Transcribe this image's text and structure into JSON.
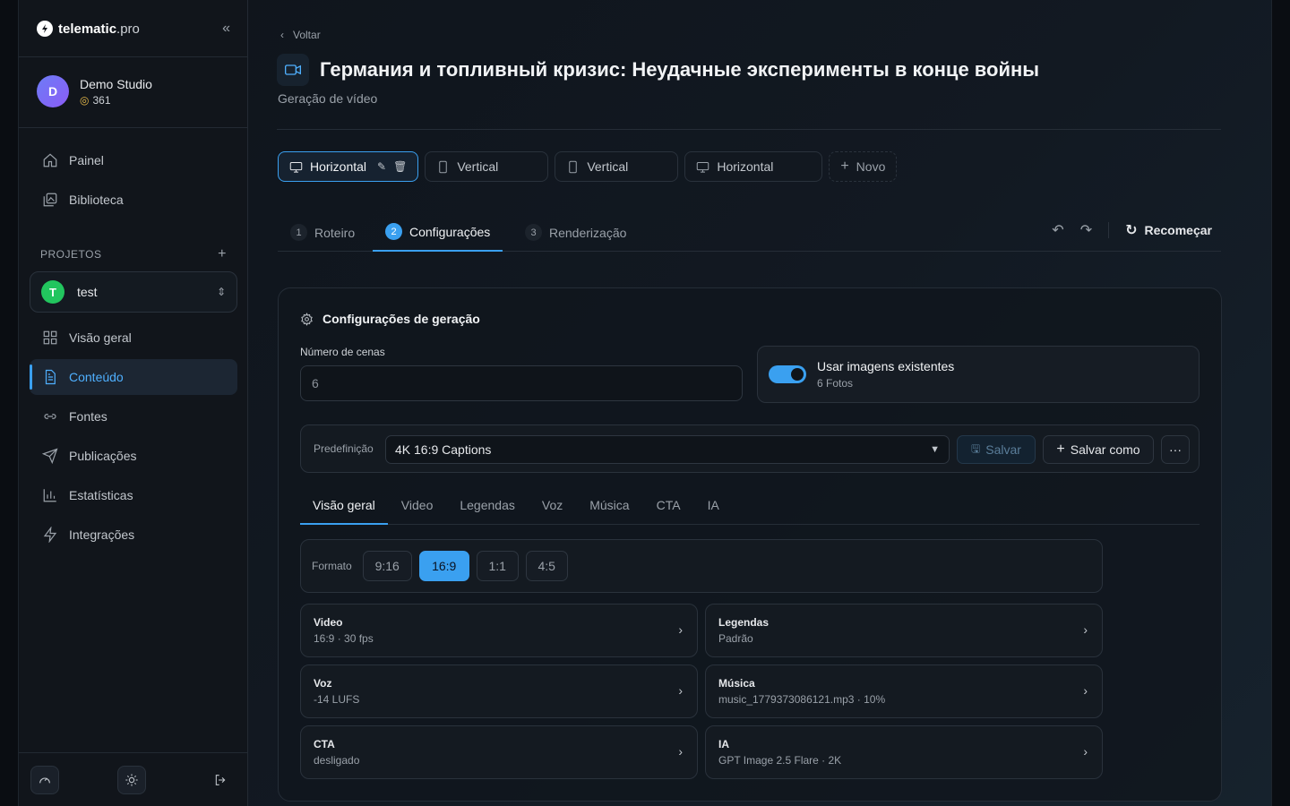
{
  "sidebar": {
    "logo": {
      "bold": "telematic",
      "thin": ".pro"
    },
    "studio": {
      "initial": "D",
      "name": "Demo Studio",
      "credits": "361"
    },
    "nav_top": [
      {
        "label": "Painel",
        "icon": "home-icon"
      },
      {
        "label": "Biblioteca",
        "icon": "library-icon"
      }
    ],
    "projects_label": "PROJETOS",
    "project": {
      "initial": "T",
      "name": "test"
    },
    "nav_project": [
      {
        "label": "Visão geral",
        "icon": "grid-icon"
      },
      {
        "label": "Conteúdo",
        "icon": "document-icon",
        "active": true
      },
      {
        "label": "Fontes",
        "icon": "link-icon"
      },
      {
        "label": "Publicações",
        "icon": "send-icon"
      },
      {
        "label": "Estatísticas",
        "icon": "bar-chart-icon"
      },
      {
        "label": "Integrações",
        "icon": "bolt-icon"
      }
    ]
  },
  "header": {
    "back": "Voltar",
    "title": "Германия и топливный кризис: Неудачные эксперименты в конце войны",
    "subtitle": "Geração de vídeo"
  },
  "variants": [
    {
      "label": "Horizontal",
      "icon": "monitor-icon",
      "active": true
    },
    {
      "label": "Vertical",
      "icon": "phone-icon"
    },
    {
      "label": "Vertical",
      "icon": "phone-icon"
    },
    {
      "label": "Horizontal",
      "icon": "monitor-icon"
    },
    {
      "label": "Novo",
      "icon": "plus-icon"
    }
  ],
  "steps": [
    {
      "num": "1",
      "label": "Roteiro"
    },
    {
      "num": "2",
      "label": "Configurações",
      "active": true
    },
    {
      "num": "3",
      "label": "Renderização"
    }
  ],
  "restart_label": "Recomeçar",
  "panel": {
    "title": "Configurações de geração",
    "scenes_label": "Número de cenas",
    "scenes_placeholder": "6",
    "use_images": {
      "title": "Usar imagens existentes",
      "sub": "6 Fotos",
      "on": true
    },
    "preset": {
      "label": "Predefinição",
      "value": "4K 16:9 Captions",
      "save": "Salvar",
      "save_as": "Salvar como"
    },
    "tabs": [
      "Visão geral",
      "Video",
      "Legendas",
      "Voz",
      "Música",
      "CTA",
      "IA"
    ],
    "format_label": "Formato",
    "formats": [
      "9:16",
      "16:9",
      "1:1",
      "4:5"
    ],
    "format_selected": "16:9",
    "settings": [
      {
        "title": "Video",
        "sub": "16:9 · 30 fps"
      },
      {
        "title": "Legendas",
        "sub": "Padrão"
      },
      {
        "title": "Voz",
        "sub": "-14 LUFS"
      },
      {
        "title": "Música",
        "sub": "music_1779373086121.mp3 · 10%"
      },
      {
        "title": "CTA",
        "sub": "desligado"
      },
      {
        "title": "IA",
        "sub": "GPT Image 2.5 Flare · 2K"
      }
    ]
  },
  "colors": {
    "accent": "#3aa0f0",
    "active_nav": "#4fb0ff",
    "project_badge": "#22c55e"
  }
}
